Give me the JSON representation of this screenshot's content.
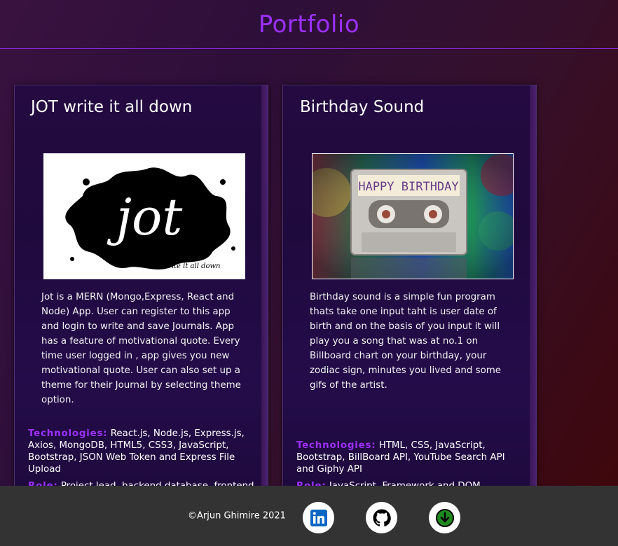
{
  "header": {
    "title": "Portfolio"
  },
  "projects": [
    {
      "title": "JOT write it all down",
      "image_alt": "jot",
      "image_caption": "write it all down",
      "description": "Jot is a MERN (Mongo,Express, React and Node) App. User can register to this app and login to write and save Journals. App has a feature of motivational quote. Every time user logged in , app gives you new motivational quote. User can also set up a theme for their Journal by selecting theme option.",
      "tech_label": "Technologies:",
      "tech": "React.js, Node.js, Express.js, Axios, MongoDB, HTML5, CSS3, JavaScript, Bootstrap, JSON Web Token and Express File Upload",
      "role_label": "Role:",
      "role": "Project lead, backend database, frontend"
    },
    {
      "title": "Birthday Sound",
      "image_caption": "HAPPY BIRTHDAY",
      "description": "Birthday sound is a simple fun program thats take one input taht is user date of birth and on the basis of you input it will play you a song that was at no.1 on Billboard chart on your birthday, your zodiac sign, minutes you lived and some gifs of the artist.",
      "tech_label": "Technologies:",
      "tech": "HTML, CSS, JavaScript, Bootstrap, BillBoard API, YouTube Search API and Giphy API",
      "role_label": "Role:",
      "role": "JavaScript, Framework and DOM"
    }
  ],
  "footer": {
    "copyright": "©Arjun Ghimire 2021",
    "links": [
      {
        "icon": "linkedin-icon",
        "color": "#0a66c2"
      },
      {
        "icon": "github-icon",
        "color": "#000000"
      },
      {
        "icon": "download-icon",
        "color": "#1f8a1f"
      }
    ]
  }
}
